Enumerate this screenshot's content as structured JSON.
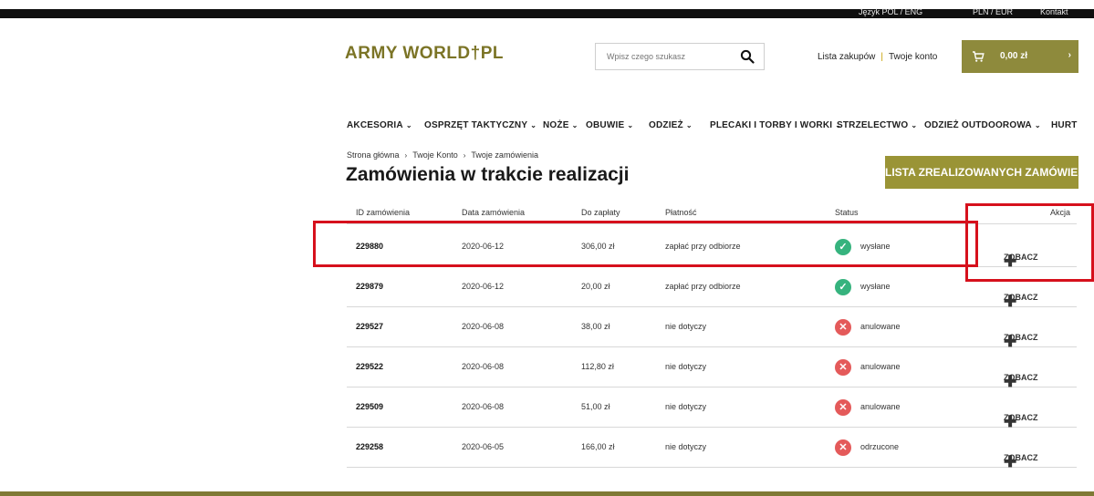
{
  "topbar": {
    "language": "Język  POL / ENG",
    "currency": "PLN / EUR",
    "contact": "Kontakt"
  },
  "header": {
    "logo": "ARMY WORLD†PL",
    "search_placeholder": "Wpisz czego szukasz",
    "shopping_list": "Lista zakupów",
    "account": "Twoje konto",
    "separator": "|",
    "cart_amount": "0,00 zł",
    "cart_arrow": "›"
  },
  "nav": [
    {
      "label": "AKCESORIA"
    },
    {
      "label": "OSPRZĘT TAKTYCZNY"
    },
    {
      "label": "NOŻE"
    },
    {
      "label": "OBUWIE"
    },
    {
      "label": "ODZIEŻ"
    },
    {
      "label": "PLECAKI I TORBY I WORKI"
    },
    {
      "label": "STRZELECTWO"
    },
    {
      "label": "ODZIEŻ OUTDOOROWA"
    },
    {
      "label": "HURT"
    }
  ],
  "breadcrumb": {
    "home": "Strona główna",
    "account": "Twoje Konto",
    "orders": "Twoje zamówienia"
  },
  "page": {
    "title": "Zamówienia w trakcie realizacji",
    "completed_button": "LISTA ZREALIZOWANYCH ZAMÓWIEŃ"
  },
  "table": {
    "headers": {
      "id": "ID zamówienia",
      "date": "Data zamówienia",
      "amount": "Do zapłaty",
      "payment": "Płatność",
      "status": "Status",
      "action": "Akcja"
    },
    "view_label": "ZOBACZ",
    "rows": [
      {
        "id": "229880",
        "date": "2020-06-12",
        "amount": "306,00 zł",
        "payment": "zapłać przy odbiorze",
        "status": "wysłane"
      },
      {
        "id": "229879",
        "date": "2020-06-12",
        "amount": "20,00 zł",
        "payment": "zapłać przy odbiorze",
        "status": "wysłane"
      },
      {
        "id": "229527",
        "date": "2020-06-08",
        "amount": "38,00 zł",
        "payment": "nie dotyczy",
        "status": "anulowane"
      },
      {
        "id": "229522",
        "date": "2020-06-08",
        "amount": "112,80 zł",
        "payment": "nie dotyczy",
        "status": "anulowane"
      },
      {
        "id": "229509",
        "date": "2020-06-08",
        "amount": "51,00 zł",
        "payment": "nie dotyczy",
        "status": "anulowane"
      },
      {
        "id": "229258",
        "date": "2020-06-05",
        "amount": "166,00 zł",
        "payment": "nie dotyczy",
        "status": "odrzucone"
      }
    ]
  },
  "colors": {
    "brand": "#8e8a3c",
    "status_ok": "#36b37e",
    "status_bad": "#e45a5a",
    "annotation": "#d6101c"
  },
  "icons": {
    "search": "search-icon",
    "cart": "cart-icon",
    "check": "check-circle-icon",
    "cross": "x-circle-icon",
    "plus": "plus-icon"
  }
}
